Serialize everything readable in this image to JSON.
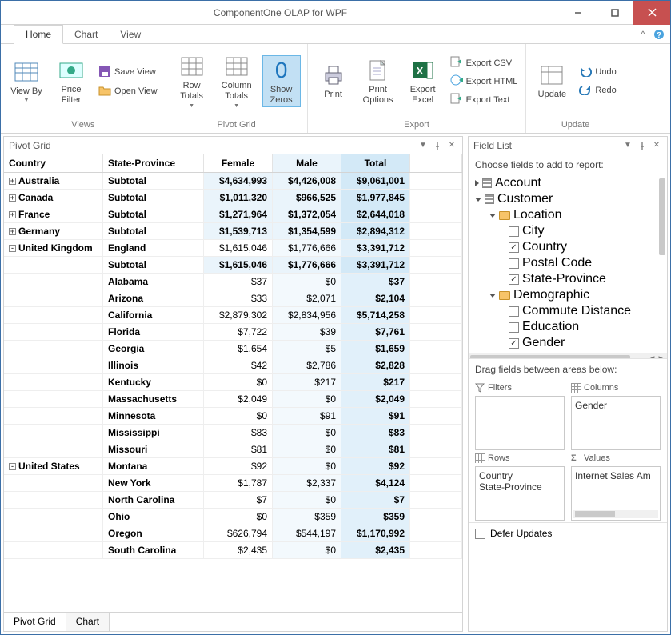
{
  "window": {
    "title": "ComponentOne OLAP for WPF"
  },
  "tabs": {
    "home": "Home",
    "chart": "Chart",
    "view": "View"
  },
  "ribbon": {
    "views": {
      "view_by": "View By",
      "price_filter": "Price\nFilter",
      "save_view": "Save View",
      "open_view": "Open View",
      "group": "Views"
    },
    "pivot": {
      "row_totals": "Row\nTotals",
      "column_totals": "Column\nTotals",
      "show_zeros": "Show\nZeros",
      "group": "Pivot Grid",
      "zero": "0"
    },
    "export": {
      "print": "Print",
      "print_options": "Print\nOptions",
      "export_excel": "Export\nExcel",
      "csv": "Export CSV",
      "html": "Export HTML",
      "text": "Export Text",
      "group": "Export"
    },
    "update": {
      "update": "Update",
      "undo": "Undo",
      "redo": "Redo",
      "group": "Update"
    }
  },
  "panels": {
    "pivot_grid": "Pivot Grid",
    "field_list": "Field List"
  },
  "headers": {
    "country": "Country",
    "state": "State-Province",
    "female": "Female",
    "male": "Male",
    "total": "Total"
  },
  "rows": [
    {
      "exp": "+",
      "country": "Australia",
      "state": "Subtotal",
      "f": "$4,634,993",
      "m": "$4,426,008",
      "t": "$9,061,001",
      "sub": true
    },
    {
      "exp": "+",
      "country": "Canada",
      "state": "Subtotal",
      "f": "$1,011,320",
      "m": "$966,525",
      "t": "$1,977,845",
      "sub": true
    },
    {
      "exp": "+",
      "country": "France",
      "state": "Subtotal",
      "f": "$1,271,964",
      "m": "$1,372,054",
      "t": "$2,644,018",
      "sub": true
    },
    {
      "exp": "+",
      "country": "Germany",
      "state": "Subtotal",
      "f": "$1,539,713",
      "m": "$1,354,599",
      "t": "$2,894,312",
      "sub": true
    },
    {
      "exp": "-",
      "country": "United Kingdom",
      "state": "England",
      "f": "$1,615,046",
      "m": "$1,776,666",
      "t": "$3,391,712",
      "sub": false
    },
    {
      "exp": "",
      "country": "",
      "state": "Subtotal",
      "f": "$1,615,046",
      "m": "$1,776,666",
      "t": "$3,391,712",
      "sub": true
    },
    {
      "exp": "",
      "country": "",
      "state": "Alabama",
      "f": "$37",
      "m": "$0",
      "t": "$37",
      "sub": false
    },
    {
      "exp": "",
      "country": "",
      "state": "Arizona",
      "f": "$33",
      "m": "$2,071",
      "t": "$2,104",
      "sub": false
    },
    {
      "exp": "",
      "country": "",
      "state": "California",
      "f": "$2,879,302",
      "m": "$2,834,956",
      "t": "$5,714,258",
      "sub": false
    },
    {
      "exp": "",
      "country": "",
      "state": "Florida",
      "f": "$7,722",
      "m": "$39",
      "t": "$7,761",
      "sub": false
    },
    {
      "exp": "",
      "country": "",
      "state": "Georgia",
      "f": "$1,654",
      "m": "$5",
      "t": "$1,659",
      "sub": false
    },
    {
      "exp": "",
      "country": "",
      "state": "Illinois",
      "f": "$42",
      "m": "$2,786",
      "t": "$2,828",
      "sub": false
    },
    {
      "exp": "",
      "country": "",
      "state": "Kentucky",
      "f": "$0",
      "m": "$217",
      "t": "$217",
      "sub": false
    },
    {
      "exp": "",
      "country": "",
      "state": "Massachusetts",
      "f": "$2,049",
      "m": "$0",
      "t": "$2,049",
      "sub": false
    },
    {
      "exp": "",
      "country": "",
      "state": "Minnesota",
      "f": "$0",
      "m": "$91",
      "t": "$91",
      "sub": false
    },
    {
      "exp": "",
      "country": "",
      "state": "Mississippi",
      "f": "$83",
      "m": "$0",
      "t": "$83",
      "sub": false
    },
    {
      "exp": "",
      "country": "",
      "state": "Missouri",
      "f": "$81",
      "m": "$0",
      "t": "$81",
      "sub": false
    },
    {
      "exp": "-",
      "country": "United States",
      "state": "Montana",
      "f": "$92",
      "m": "$0",
      "t": "$92",
      "sub": false
    },
    {
      "exp": "",
      "country": "",
      "state": "New York",
      "f": "$1,787",
      "m": "$2,337",
      "t": "$4,124",
      "sub": false
    },
    {
      "exp": "",
      "country": "",
      "state": "North Carolina",
      "f": "$7",
      "m": "$0",
      "t": "$7",
      "sub": false
    },
    {
      "exp": "",
      "country": "",
      "state": "Ohio",
      "f": "$0",
      "m": "$359",
      "t": "$359",
      "sub": false
    },
    {
      "exp": "",
      "country": "",
      "state": "Oregon",
      "f": "$626,794",
      "m": "$544,197",
      "t": "$1,170,992",
      "sub": false
    },
    {
      "exp": "",
      "country": "",
      "state": "South Carolina",
      "f": "$2,435",
      "m": "$0",
      "t": "$2,435",
      "sub": false
    }
  ],
  "bottom_tabs": {
    "pivot": "Pivot Grid",
    "chart": "Chart"
  },
  "fieldlist": {
    "hint": "Choose fields to add to report:",
    "tree": {
      "account": "Account",
      "customer": "Customer",
      "location": "Location",
      "city": "City",
      "country": "Country",
      "postal": "Postal Code",
      "state": "State-Province",
      "demographic": "Demographic",
      "commute": "Commute Distance",
      "education": "Education",
      "gender": "Gender"
    },
    "drag": "Drag fields between areas below:",
    "filters": "Filters",
    "columns": "Columns",
    "rows": "Rows",
    "values": "Values",
    "col_item": "Gender",
    "row_item1": "Country",
    "row_item2": "State-Province",
    "val_item": "Internet Sales Am",
    "defer": "Defer Updates"
  }
}
